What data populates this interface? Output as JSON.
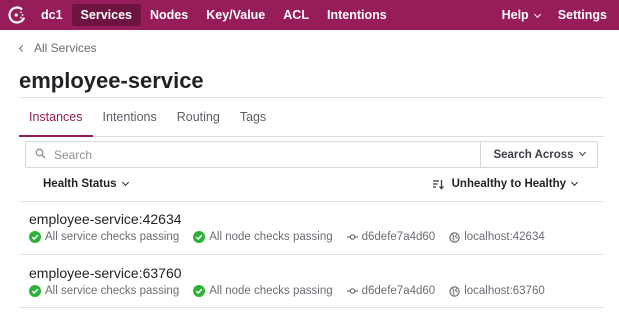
{
  "colors": {
    "brand": "#961d59",
    "brand_dark": "#6e1441",
    "passing": "#2eb039"
  },
  "nav": {
    "logo_icon": "consul-logo-icon",
    "datacenter": "dc1",
    "items": [
      "Services",
      "Nodes",
      "Key/Value",
      "ACL",
      "Intentions"
    ],
    "active": "Services",
    "help_label": "Help",
    "settings_label": "Settings"
  },
  "breadcrumb": {
    "label": "All Services"
  },
  "page": {
    "title": "employee-service"
  },
  "tabs": [
    "Instances",
    "Intentions",
    "Routing",
    "Tags"
  ],
  "active_tab": "Instances",
  "search": {
    "placeholder": "Search",
    "scope_label": "Search Across"
  },
  "filters": {
    "health_label": "Health Status",
    "sort_label": "Unhealthy to Healthy"
  },
  "instances": [
    {
      "name": "employee-service:42634",
      "service_checks": "All service checks passing",
      "node_checks": "All node checks passing",
      "node_id": "d6defe7a4d60",
      "address": "localhost:42634"
    },
    {
      "name": "employee-service:63760",
      "service_checks": "All service checks passing",
      "node_checks": "All node checks passing",
      "node_id": "d6defe7a4d60",
      "address": "localhost:63760"
    }
  ]
}
